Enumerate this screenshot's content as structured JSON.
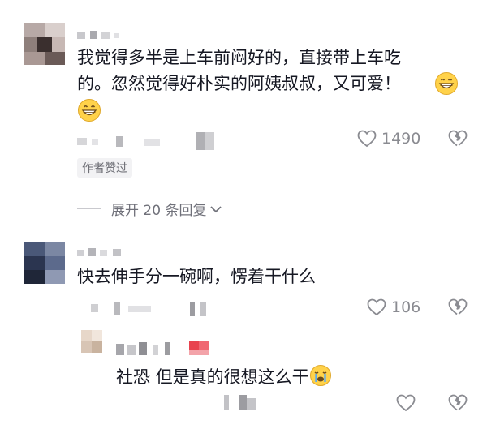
{
  "comments": [
    {
      "text_line1": "我觉得多半是上车前闷好的，直接带上车吃",
      "text_line2": "的。忽然觉得好朴实的阿姨叔叔，又可爱！",
      "likes": "1490",
      "author_liked_badge": "作者赞过",
      "expand_label": "展开 20 条回复",
      "emoji_names": [
        "grinning-emoji",
        "grinning-emoji"
      ]
    },
    {
      "text": "快去伸手分一碗啊，愣着干什么",
      "likes": "106"
    },
    {
      "text": "社恐 但是真的很想这么干",
      "likes": "",
      "emoji_name": "crying-emoji"
    }
  ],
  "colors": {
    "text": "#161823",
    "meta": "#8a8b91",
    "badge_bg": "#f2f2f4",
    "accent_red": "#e8434f"
  },
  "icons": [
    "heart-outline-icon",
    "broken-heart-icon",
    "chevron-down-icon"
  ]
}
